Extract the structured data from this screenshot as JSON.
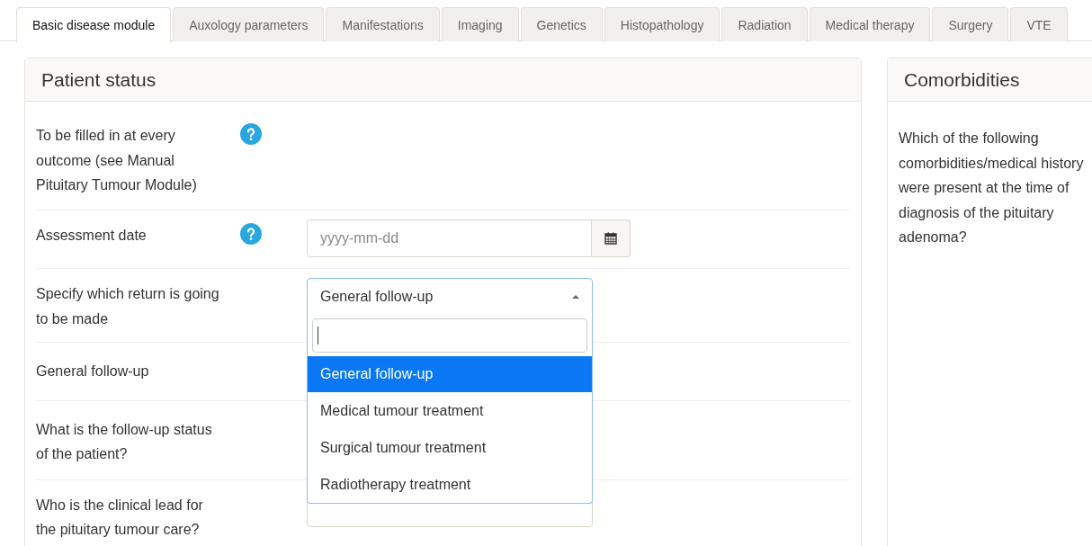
{
  "tabs": [
    {
      "label": "Basic disease module",
      "selected": true
    },
    {
      "label": "Auxology parameters",
      "selected": false
    },
    {
      "label": "Manifestations",
      "selected": false
    },
    {
      "label": "Imaging",
      "selected": false
    },
    {
      "label": "Genetics",
      "selected": false
    },
    {
      "label": "Histopathology",
      "selected": false
    },
    {
      "label": "Radiation",
      "selected": false
    },
    {
      "label": "Medical therapy",
      "selected": false
    },
    {
      "label": "Surgery",
      "selected": false
    },
    {
      "label": "VTE",
      "selected": false
    }
  ],
  "patient_status": {
    "title": "Patient status",
    "rows": [
      {
        "kind": "text",
        "label": "To be filled in at every outcome (see Manual Pituitary Tumour Module)",
        "help": true
      },
      {
        "kind": "date",
        "label": "Assessment date",
        "help": true,
        "placeholder": "yyyy-mm-dd"
      },
      {
        "kind": "select",
        "label": "Specify which return is going to be made",
        "help": false,
        "value": "General follow-up",
        "open": true,
        "options": [
          {
            "label": "General follow-up",
            "selected": true
          },
          {
            "label": "Medical tumour treatment",
            "selected": false
          },
          {
            "label": "Surgical tumour treatment",
            "selected": false
          },
          {
            "label": "Radiotherapy treatment",
            "selected": false
          }
        ]
      },
      {
        "kind": "text",
        "label": "General follow-up",
        "help": false
      },
      {
        "kind": "text",
        "label": "What is the follow-up status of the patient?",
        "help": false
      },
      {
        "kind": "select",
        "label": "Who is the clinical lead for the pituitary tumour care?",
        "help": false,
        "open": false
      }
    ]
  },
  "comorbidities": {
    "title": "Comorbidities",
    "text": "Which of the following comorbidities/medical history were present at the time of diagnosis of the pituitary adenoma?"
  }
}
